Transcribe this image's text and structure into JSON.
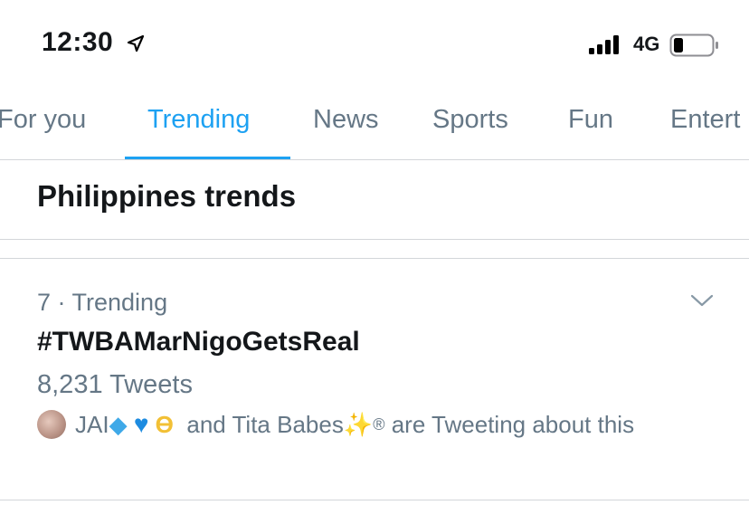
{
  "status_bar": {
    "time": "12:30",
    "network": "4G"
  },
  "tabs": [
    {
      "label": "For you"
    },
    {
      "label": "Trending"
    },
    {
      "label": "News"
    },
    {
      "label": "Sports"
    },
    {
      "label": "Fun"
    },
    {
      "label": "Entert"
    }
  ],
  "section": {
    "title": "Philippines trends"
  },
  "trend": {
    "meta": "7 · Trending",
    "name": "#TWBAMarNigoGetsReal",
    "count": "8,231 Tweets",
    "context": {
      "user1": "JAI",
      "connector": "and",
      "user2": "Tita Babes",
      "suffix": "are Tweeting about this"
    }
  },
  "colors": {
    "accent": "#1da1f2",
    "secondary_text": "#657786",
    "primary_text": "#14171a"
  }
}
